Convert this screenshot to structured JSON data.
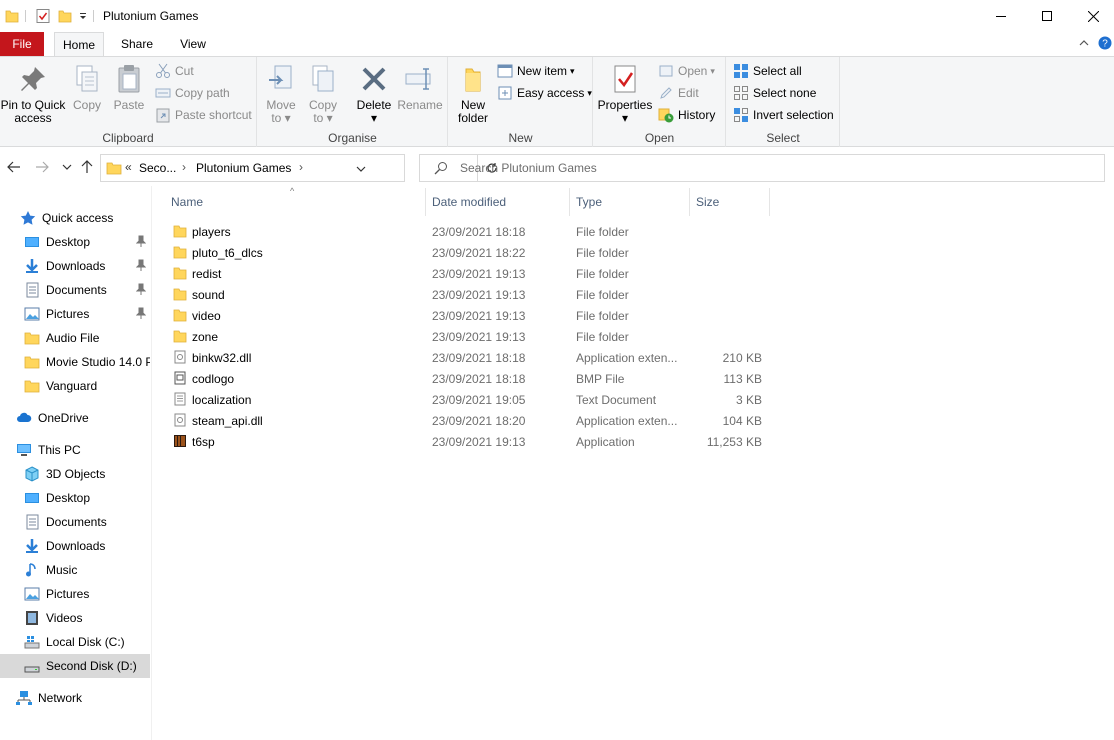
{
  "window": {
    "title": "Plutonium Games"
  },
  "tabs": [
    {
      "label": "File"
    },
    {
      "label": "Home"
    },
    {
      "label": "Share"
    },
    {
      "label": "View"
    }
  ],
  "ribbon": {
    "clipboard": {
      "label": "Clipboard",
      "pin": "Pin to Quick",
      "pin2": "access",
      "copy": "Copy",
      "paste": "Paste",
      "cut": "Cut",
      "copy_path": "Copy path",
      "paste_shortcut": "Paste shortcut"
    },
    "organise": {
      "label": "Organise",
      "move": "Move",
      "move2": "to",
      "copy": "Copy",
      "copy2": "to",
      "delete": "Delete",
      "rename": "Rename"
    },
    "new": {
      "label": "New",
      "new_folder": "New",
      "new_folder2": "folder",
      "new_item": "New item",
      "easy_access": "Easy access"
    },
    "open": {
      "label": "Open",
      "properties": "Properties",
      "open": "Open",
      "edit": "Edit",
      "history": "History"
    },
    "select": {
      "label": "Select",
      "select_all": "Select all",
      "select_none": "Select none",
      "invert": "Invert selection"
    }
  },
  "address": {
    "overflow": "«",
    "crumb1": "Seco...",
    "crumb2": "Plutonium Games",
    "sep": "›"
  },
  "search": {
    "placeholder": "Search Plutonium Games"
  },
  "nav": {
    "quick_access": "Quick access",
    "quick_items": [
      {
        "label": "Desktop"
      },
      {
        "label": "Downloads"
      },
      {
        "label": "Documents"
      },
      {
        "label": "Pictures"
      },
      {
        "label": "Audio File"
      },
      {
        "label": "Movie Studio 14.0 P"
      },
      {
        "label": "Vanguard"
      }
    ],
    "onedrive": "OneDrive",
    "this_pc": "This PC",
    "pc_items": [
      {
        "label": "3D Objects"
      },
      {
        "label": "Desktop"
      },
      {
        "label": "Documents"
      },
      {
        "label": "Downloads"
      },
      {
        "label": "Music"
      },
      {
        "label": "Pictures"
      },
      {
        "label": "Videos"
      },
      {
        "label": "Local Disk (C:)"
      },
      {
        "label": "Second Disk (D:)"
      }
    ],
    "network": "Network"
  },
  "columns": {
    "name": "Name",
    "date": "Date modified",
    "type": "Type",
    "size": "Size"
  },
  "files": [
    {
      "name": "players",
      "date": "23/09/2021 18:18",
      "type": "File folder",
      "size": "",
      "icon": "folder"
    },
    {
      "name": "pluto_t6_dlcs",
      "date": "23/09/2021 18:22",
      "type": "File folder",
      "size": "",
      "icon": "folder"
    },
    {
      "name": "redist",
      "date": "23/09/2021 19:13",
      "type": "File folder",
      "size": "",
      "icon": "folder"
    },
    {
      "name": "sound",
      "date": "23/09/2021 19:13",
      "type": "File folder",
      "size": "",
      "icon": "folder"
    },
    {
      "name": "video",
      "date": "23/09/2021 19:13",
      "type": "File folder",
      "size": "",
      "icon": "folder"
    },
    {
      "name": "zone",
      "date": "23/09/2021 19:13",
      "type": "File folder",
      "size": "",
      "icon": "folder"
    },
    {
      "name": "binkw32.dll",
      "date": "23/09/2021 18:18",
      "type": "Application exten...",
      "size": "210 KB",
      "icon": "dll"
    },
    {
      "name": "codlogo",
      "date": "23/09/2021 18:18",
      "type": "BMP File",
      "size": "113 KB",
      "icon": "bmp"
    },
    {
      "name": "localization",
      "date": "23/09/2021 19:05",
      "type": "Text Document",
      "size": "3 KB",
      "icon": "txt"
    },
    {
      "name": "steam_api.dll",
      "date": "23/09/2021 18:20",
      "type": "Application exten...",
      "size": "104 KB",
      "icon": "dll"
    },
    {
      "name": "t6sp",
      "date": "23/09/2021 19:13",
      "type": "Application",
      "size": "11,253 KB",
      "icon": "exe"
    }
  ]
}
